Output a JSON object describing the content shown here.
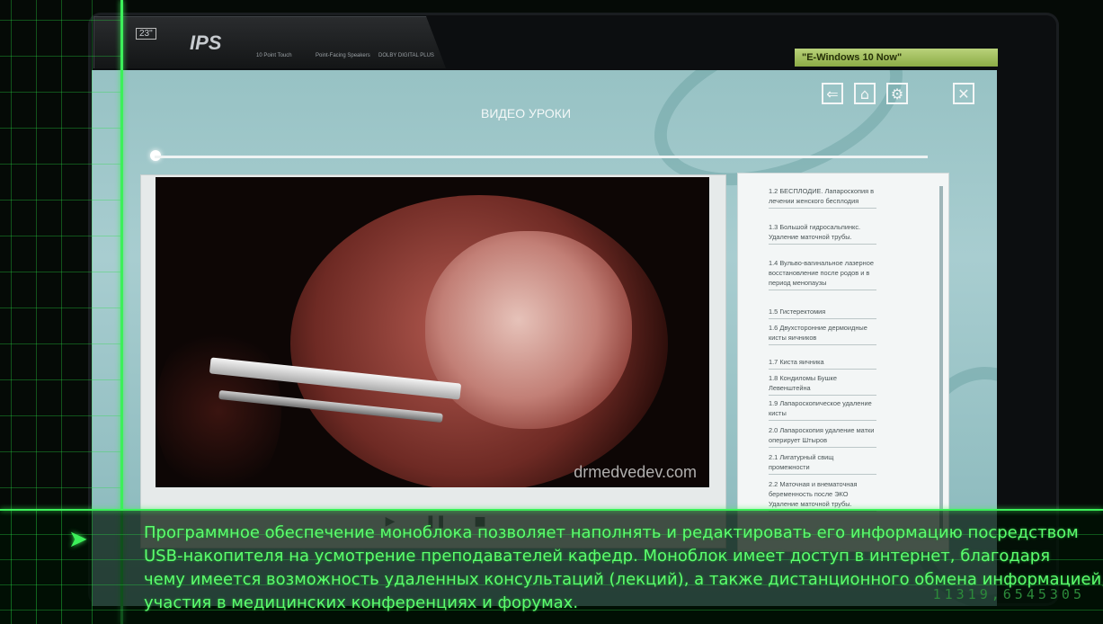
{
  "monitor": {
    "badges": [
      "23\"",
      "IPS",
      "10 Point Touch",
      "Point-Facing Speakers",
      "DOLBY DIGITAL PLUS"
    ],
    "sticker": "\"E-Windows 10 Now\""
  },
  "screen": {
    "title": "ВИДЕО УРОКИ",
    "icons": {
      "back": "back-arrow-icon",
      "home": "home-icon",
      "settings": "gear-icon",
      "close": "close-icon"
    }
  },
  "video": {
    "watermark": "drmedvedev.com"
  },
  "playlist": {
    "items": [
      "1.2 БЕСПЛОДИЕ. Лапароскопия в лечении женского бесплодия",
      "1.3 Большой гидросальпинкс. Удаление маточной трубы.",
      "1.4 Вульво-вагинальное лазерное восстановление после родов и в период менопаузы",
      "1.5 Гистеректомия",
      "1.6 Двухсторонние дермоидные кисты яичников",
      "1.7 Киста яичника",
      "1.8 Кондиломы Бушке Левенштейна",
      "1.9 Лапароскопическое удаление кисты",
      "2.0 Лапароскопия удаление матки оперирует Штыров",
      "2.1 Лигатурный свищ промежности",
      "2.2 Маточная и внематочная беременность после ЭКО Удаление маточной трубы."
    ]
  },
  "hud": {
    "caption": [
      "Программное обеспечение моноблока позволяет наполнять и редактировать его информацию посредством",
      "USB-накопителя на усмотрение преподавателей кафедр. Моноблок имеет доступ в интернет, благодаря",
      "чему имеется возможность удаленных консультаций (лекций), а также дистанционного обмена информацией,",
      "участия в медицинских конференциях и форумах."
    ],
    "counter": "11319,6545305",
    "accent": "#3cf05a"
  }
}
